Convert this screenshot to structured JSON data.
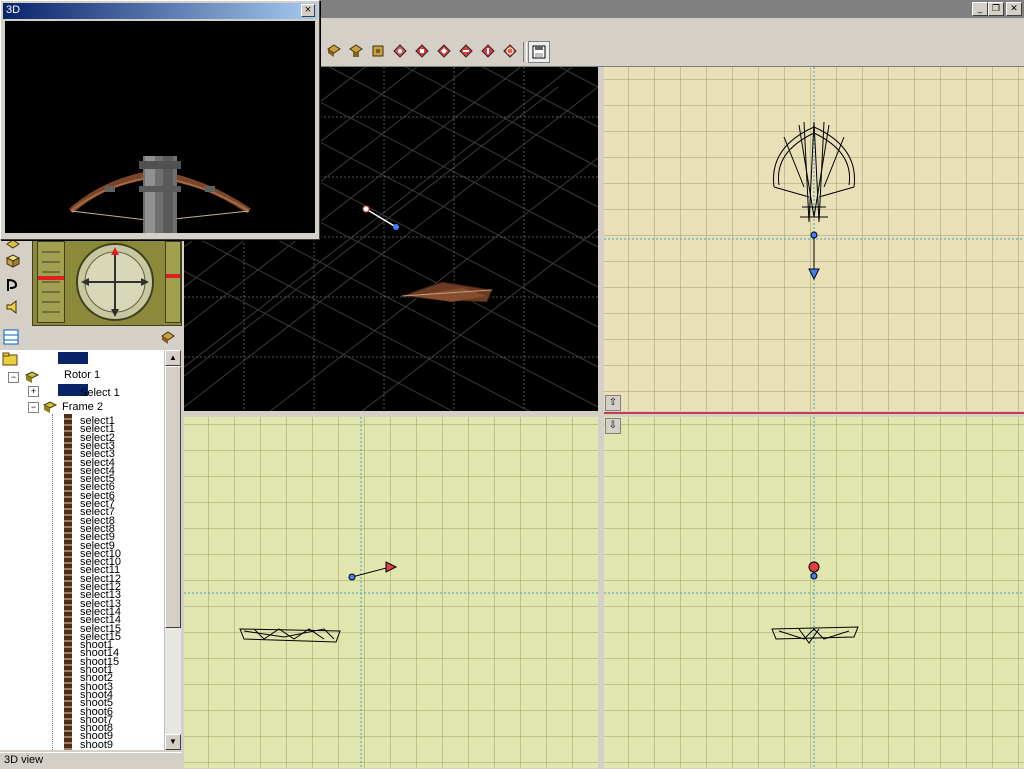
{
  "main_window": {
    "title": "",
    "controls": [
      "minimize-icon",
      "restore-icon",
      "close-icon"
    ]
  },
  "toolbar": {
    "buttons": [
      "view-icon-1",
      "view-icon-2",
      "view-icon-3",
      "view-icon-4",
      "view-icon-5",
      "view-icon-6",
      "view-icon-7",
      "view-icon-8",
      "save-icon"
    ]
  },
  "viewports": {
    "perspective": {
      "background": "#000000"
    },
    "top": {
      "background": "#e9e0b8",
      "corner_icon": "arrow-up-icon"
    },
    "front": {
      "background": "#e1e6ae"
    },
    "side": {
      "background": "#e1e6ae",
      "corner_icon": "arrow-down-icon"
    }
  },
  "floating_window": {
    "title": "3D",
    "close_label": "×"
  },
  "tree": {
    "header_items": [
      "Rotor 1",
      "Select 1",
      "Frame 2"
    ],
    "rows": [
      "select1",
      "select1",
      "select2",
      "select3",
      "select3",
      "select4",
      "select4",
      "select5",
      "select6",
      "select6",
      "select7",
      "select7",
      "select8",
      "select8",
      "select9",
      "select9",
      "select10",
      "select10",
      "select11",
      "select12",
      "select12",
      "select13",
      "select13",
      "select14",
      "select14",
      "select15",
      "select15",
      "shoot1",
      "shoot14",
      "shoot15",
      "shoot1",
      "shoot2",
      "shoot3",
      "shoot4",
      "shoot5",
      "shoot6",
      "shoot7",
      "shoot8",
      "shoot9",
      "shoot9"
    ]
  },
  "statusbar": {
    "text": "3D view"
  },
  "colors": {
    "accent": "#0a246a",
    "grid_beige": "#e9e0b8",
    "grid_green": "#e1e6ae",
    "splitter_red": "#c04040"
  }
}
